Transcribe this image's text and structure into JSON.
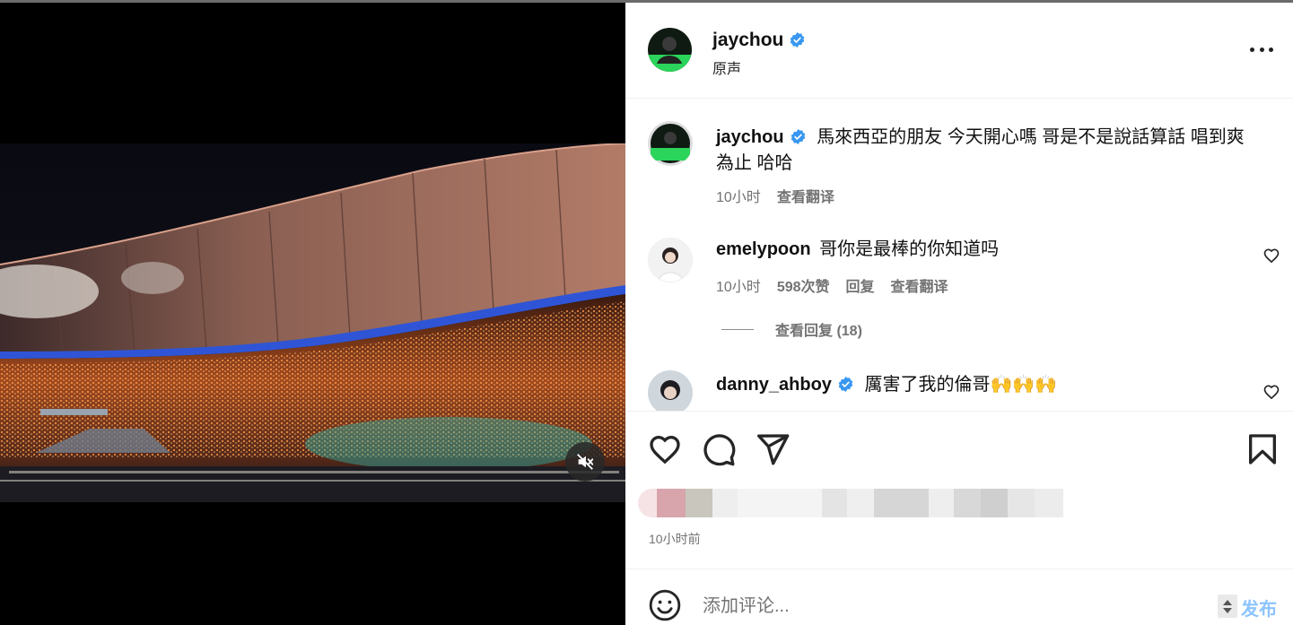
{
  "post": {
    "author": "jaychou",
    "audio_label": "原声",
    "caption": "馬來西亞的朋友 今天開心嗎 哥是不是說話算話 唱到爽為止 哈哈",
    "caption_time": "10小时",
    "translate_label": "查看翻译",
    "posted_ago": "10小时前"
  },
  "comments": [
    {
      "user": "emelypoon",
      "text": "哥你是最棒的你知道吗",
      "time": "10小时",
      "likes": "598次赞",
      "reply_label": "回复",
      "translate_label": "查看翻译",
      "view_replies": "查看回复 (18)"
    },
    {
      "user": "danny_ahboy",
      "text": "厲害了我的倫哥🙌🙌🙌",
      "verified": true
    }
  ],
  "composer": {
    "placeholder": "添加评论...",
    "post_label": "发布"
  },
  "icons": {
    "verified": "verified-badge-icon",
    "more": "more-options-icon",
    "mute": "muted-speaker-icon",
    "like": "heart-icon",
    "comment": "comment-bubble-icon",
    "share": "send-paper-plane-icon",
    "save": "bookmark-icon",
    "emoji": "emoji-smiley-icon"
  },
  "colors": {
    "verified_blue": "#3897f0",
    "post_button_disabled": "#8cc4ff",
    "muted_text": "#737373"
  }
}
